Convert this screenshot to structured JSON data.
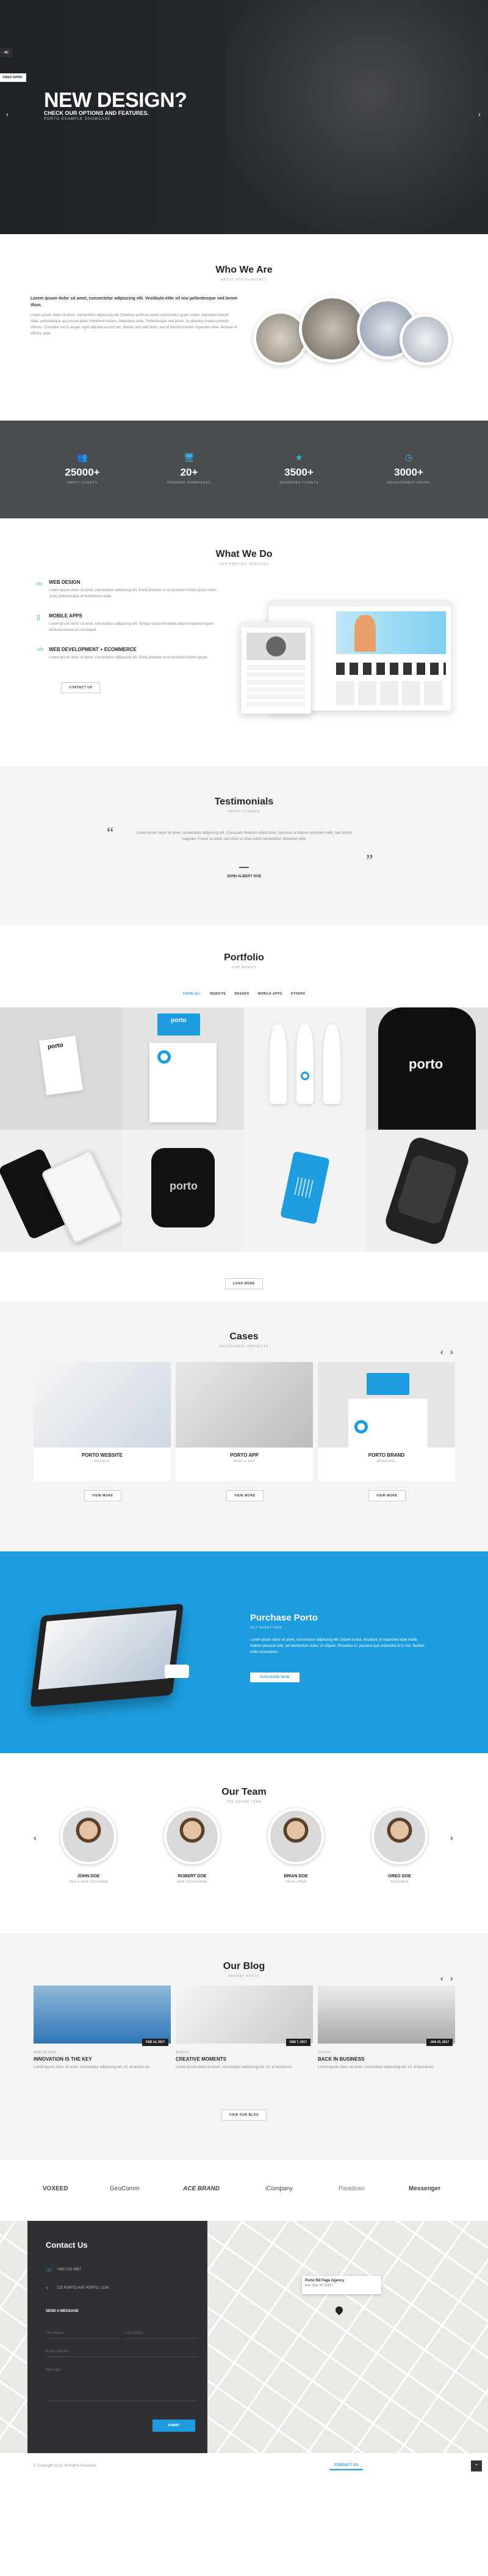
{
  "hero": {
    "chip_label": "VIDEO INTRO",
    "title": "NEW DESIGN?",
    "subtitle": "CHECK OUR OPTIONS AND FEATURES.",
    "tagline": "PORTO EXAMPLE SHOWCASE",
    "prev_arrow": "‹",
    "next_arrow": "›",
    "menu_icon": "≪"
  },
  "who": {
    "title": "Who We Are",
    "subtitle": "ABOUT PORTO AGENCY",
    "lead": "Lorem ipsum dolor sit amet, consectetur adipiscing elit. Vestibulo elite sit nisi pellentesque sed lorem illum.",
    "body": "Lorem ipsum dolor sit amet, consectetur adipiscing elit. Ententus pulvinar lorem consectetur quam nullas, imperdiet blandit vitae, pellentesque accumsan dolor. Hendrerit mauris, bibendum nulla. Pellentesque sed lorem, ut pharetra mauris pretium ultrices. Curabitur est in augue, eget aliquam accumsan. Mauris sed velit dolor, sed id tincidunt lorem imperdiet vitae. Aenean et efficitur ante."
  },
  "stats": [
    {
      "icon": "users-icon",
      "glyph": "👥",
      "number": "25000+",
      "label": "HAPPY CLIENTS"
    },
    {
      "icon": "monitor-icon",
      "glyph": "🖥",
      "number": "20+",
      "label": "PREMADE HOMEPAGES"
    },
    {
      "icon": "star-icon",
      "glyph": "★",
      "number": "3500+",
      "label": "ANSWERED TICKETS"
    },
    {
      "icon": "clock-icon",
      "glyph": "◷",
      "number": "3000+",
      "label": "DEVELOPMENT HOURS"
    }
  ],
  "what": {
    "title": "What We Do",
    "subtitle": "OUR AMAZING SERVICES",
    "services": [
      {
        "icon": "screen-icon",
        "glyph": "▭",
        "title": "WEB DESIGN",
        "text": "Lorem ipsum dolor sit amet, consectetur adipiscing elit. Porta dolorem et ut provident lorem ipsum nunc. Justo pellentesque et fermentum nulla."
      },
      {
        "icon": "phone-icon",
        "glyph": "▯",
        "title": "MOBILE APPS",
        "text": "Lorem ipsum dolor sit amet, consectetur adipiscing elit. Tempor luctus tincidunt aliquet maximus quam vehicula massa et consequat."
      },
      {
        "icon": "code-icon",
        "glyph": "</>",
        "title": "WEB DEVELOPMENT + ECOMMERCE",
        "text": "Lorem ipsum dolor sit amet, consectetur adipiscing elit. Porta dolorem et ut provident lorem ipsum."
      }
    ],
    "button": "CONTACT US"
  },
  "testimonials": {
    "title": "Testimonials",
    "subtitle": "HAPPY CLIENTS",
    "quote": "Lorem ipsum dolor sit amet, consectetur adipiscing elit. Quisquam delectus ullam dolor, ducimus ut dolores provident velit, sed dolore magnam. Fusce sit amet, sed dolor ut vitae porta consectetur, doloribus velit.",
    "author": "JOHN ALBERT DOE",
    "open_quote": "“",
    "close_quote": "”"
  },
  "portfolio": {
    "title": "Portfolio",
    "subtitle": "OUR WORKS",
    "filters": [
      "SHOW ALL",
      "WEBSITE",
      "BRANDS",
      "MOBILE APPS",
      "OTHERS"
    ],
    "tile_word": "porto",
    "button": "LOAD MORE"
  },
  "cases": {
    "title": "Cases",
    "subtitle": "SUCCESSFUL PROJECTS",
    "items": [
      {
        "title": "PORTO WEBSITE",
        "sub": "WEBSITE",
        "button": "VIEW MORE"
      },
      {
        "title": "PORTO APP",
        "sub": "MOBILE APP",
        "button": "VIEW MORE"
      },
      {
        "title": "PORTO BRAND",
        "sub": "BRANDING",
        "button": "VIEW MORE"
      }
    ],
    "prev": "‹",
    "next": "›"
  },
  "purchase": {
    "title": "Purchase Porto",
    "subtitle": "GET READY NOW",
    "text": "Lorem ipsum dolor sit amet, consectetur adipiscing elit. Dolore luctus, tincidunt, in imperdiet vitae mollis. Nullam placerat velit, vel elementum dolor, Ut aliquet. Phasellus in, posuere quis imperdiet et in nisl, facilisis nulla consectetur.",
    "button": "PURCHASE NOW"
  },
  "team": {
    "title": "Our Team",
    "subtitle": "THE DREAM TEAM",
    "members": [
      {
        "name": "JOHN DOE",
        "role": "CEO & WEB DESIGNER"
      },
      {
        "name": "ROBERT DOE",
        "role": "WEB DEVELOPER"
      },
      {
        "name": "BRIAN DOE",
        "role": "DEVELOPER"
      },
      {
        "name": "GREG DOE",
        "role": "DESIGNER"
      }
    ],
    "prev": "‹",
    "next": "›"
  },
  "blog": {
    "title": "Our Blog",
    "subtitle": "RECENT POSTS",
    "posts": [
      {
        "date": "FEB 14, 2017",
        "cat": "WEB DESIGN",
        "title": "INNOVATION IS THE KEY",
        "text": "Lorem ipsum dolor sit amet, consectetur adipiscing elit. Ut, et lacinia eu."
      },
      {
        "date": "FEB 7, 2017",
        "cat": "MOBILE",
        "title": "CREATIVE MOMENTS",
        "text": "Lorem ipsum dolor sit amet, consectetur adipiscing elit. Ut, et lacinia eu."
      },
      {
        "date": "JAN 15, 2017",
        "cat": "OFFICE",
        "title": "BACK IN BUSINESS",
        "text": "Lorem ipsum dolor sit amet, consectetur adipiscing elit. Ut, et lacinia eu."
      }
    ],
    "button": "VIEW OUR BLOG",
    "prev": "‹",
    "next": "›"
  },
  "logos": [
    "VOXEED",
    "GeoComm",
    "ACE BRAND",
    "iCompany",
    "Paradoxo",
    "Messenger"
  ],
  "contact": {
    "title": "Contact Us",
    "phone": "+800 123 4567",
    "address": "123 PORTO AVE PORTO, 1234",
    "send_title": "SEND A MESSAGE",
    "placeholders": [
      "First Name",
      "Last Name",
      "Email Address",
      "Message"
    ],
    "submit": "SUBMIT",
    "map_title": "Porto Rd Page Agency",
    "map_sub": "New York, NY 10017"
  },
  "footer": {
    "copyright": "© Copyright 2018. All Rights Reserved.",
    "contact_tab": "CONTACT US"
  },
  "colors": {
    "accent": "#1d9ddf",
    "dark": "#2e3033"
  }
}
